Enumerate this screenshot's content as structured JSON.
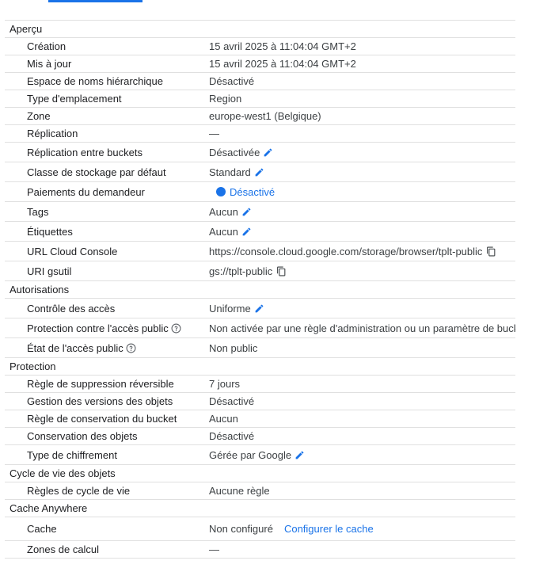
{
  "colors": {
    "accent": "#1a73e8",
    "border": "#e0e0e0",
    "text": "#202124"
  },
  "sections": {
    "apercu": {
      "title": "Aperçu"
    },
    "autorisations": {
      "title": "Autorisations"
    },
    "protection": {
      "title": "Protection"
    },
    "cycle": {
      "title": "Cycle de vie des objets"
    },
    "cache": {
      "title": "Cache Anywhere"
    }
  },
  "rows": {
    "creation": {
      "label": "Création",
      "value": "15 avril 2025 à 11:04:04 GMT+2"
    },
    "maj": {
      "label": "Mis à jour",
      "value": "15 avril 2025 à 11:04:04 GMT+2"
    },
    "hns": {
      "label": "Espace de noms hiérarchique",
      "value": "Désactivé"
    },
    "type_emplacement": {
      "label": "Type d'emplacement",
      "value": "Region"
    },
    "zone": {
      "label": "Zone",
      "value": "europe-west1 (Belgique)"
    },
    "replication": {
      "label": "Réplication",
      "value": "—"
    },
    "replication_buckets": {
      "label": "Réplication entre buckets",
      "value": "Désactivée"
    },
    "classe_stockage": {
      "label": "Classe de stockage par défaut",
      "value": "Standard"
    },
    "paiements": {
      "label": "Paiements du demandeur",
      "value": "Désactivé"
    },
    "tags": {
      "label": "Tags",
      "value": "Aucun"
    },
    "etiquettes": {
      "label": "Étiquettes",
      "value": "Aucun"
    },
    "url_console": {
      "label": "URL Cloud Console",
      "value": "https://console.cloud.google.com/storage/browser/tplt-public"
    },
    "uri_gsutil": {
      "label": "URI gsutil",
      "value": "gs://tplt-public"
    },
    "controle_acces": {
      "label": "Contrôle des accès",
      "value": "Uniforme"
    },
    "protection_public": {
      "label": "Protection contre l'accès public",
      "value": "Non activée par une règle d'administration ou un paramètre de bucket"
    },
    "etat_acces_public": {
      "label": "État de l'accès public",
      "value": "Non public"
    },
    "suppression_reversible": {
      "label": "Règle de suppression réversible",
      "value": "7 jours"
    },
    "versions_objets": {
      "label": "Gestion des versions des objets",
      "value": "Désactivé"
    },
    "conservation_bucket": {
      "label": "Règle de conservation du bucket",
      "value": "Aucun"
    },
    "conservation_objets": {
      "label": "Conservation des objets",
      "value": "Désactivé"
    },
    "chiffrement": {
      "label": "Type de chiffrement",
      "value": "Gérée par Google"
    },
    "regles_cycle": {
      "label": "Règles de cycle de vie",
      "value": "Aucune règle"
    },
    "cache": {
      "label": "Cache",
      "value": "Non configuré",
      "action": "Configurer le cache"
    },
    "zones_calcul": {
      "label": "Zones de calcul",
      "value": "—"
    }
  },
  "icons": {
    "edit": "pencil-icon",
    "copy": "copy-icon",
    "help": "help-icon",
    "status": "status-dot-icon"
  }
}
